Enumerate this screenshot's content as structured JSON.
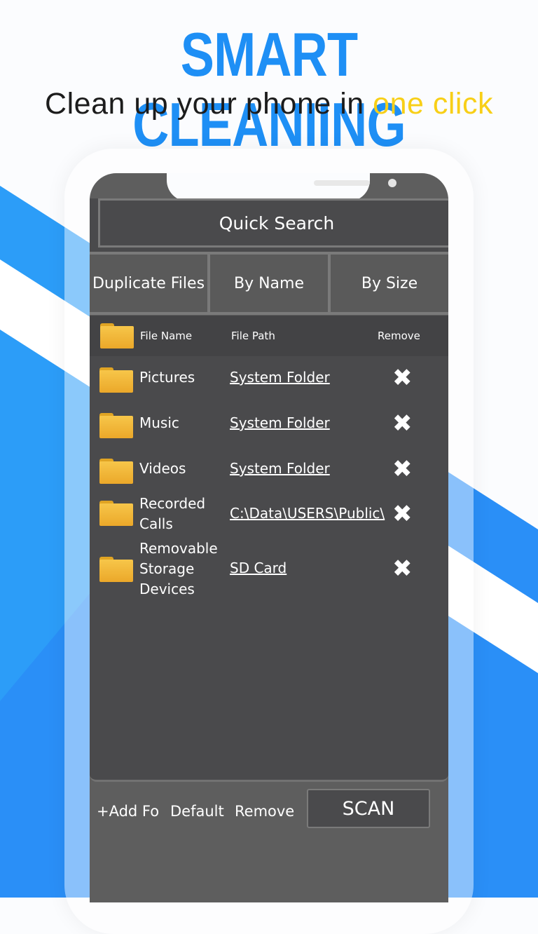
{
  "banner": {
    "title": "SMART CLEANIING",
    "subtitle_prefix": "Clean up your phone in ",
    "subtitle_highlight": "one click"
  },
  "colors": {
    "title": "#1e8ff5",
    "highlight": "#f8cf17",
    "accent_blue": "#2a8ff7",
    "screen": "#4a4a4c"
  },
  "app": {
    "header": "Quick Search",
    "tabs": [
      {
        "label": "Duplicate Files"
      },
      {
        "label": "By Name"
      },
      {
        "label": "By Size"
      }
    ],
    "table": {
      "columns": [
        "File Name",
        "File Path",
        "Remove"
      ],
      "rows": [
        {
          "name": "Pictures",
          "path": "System Folder",
          "icon": "folder-icon",
          "remove_icon": "close-icon"
        },
        {
          "name": "Music",
          "path": "System Folder",
          "icon": "folder-icon",
          "remove_icon": "close-icon"
        },
        {
          "name": "Videos",
          "path": "System Folder",
          "icon": "folder-icon",
          "remove_icon": "close-icon"
        },
        {
          "name": "Recorded Calls",
          "path": "C:\\Data\\USERS\\Public\\",
          "icon": "folder-icon",
          "remove_icon": "close-icon"
        },
        {
          "name": "Removable Storage Devices",
          "path": "SD Card",
          "icon": "folder-icon",
          "remove_icon": "close-icon"
        }
      ]
    },
    "footer": {
      "add": "+Add Fo",
      "default": "Default",
      "remove": "Remove",
      "scan": "SCAN"
    }
  }
}
